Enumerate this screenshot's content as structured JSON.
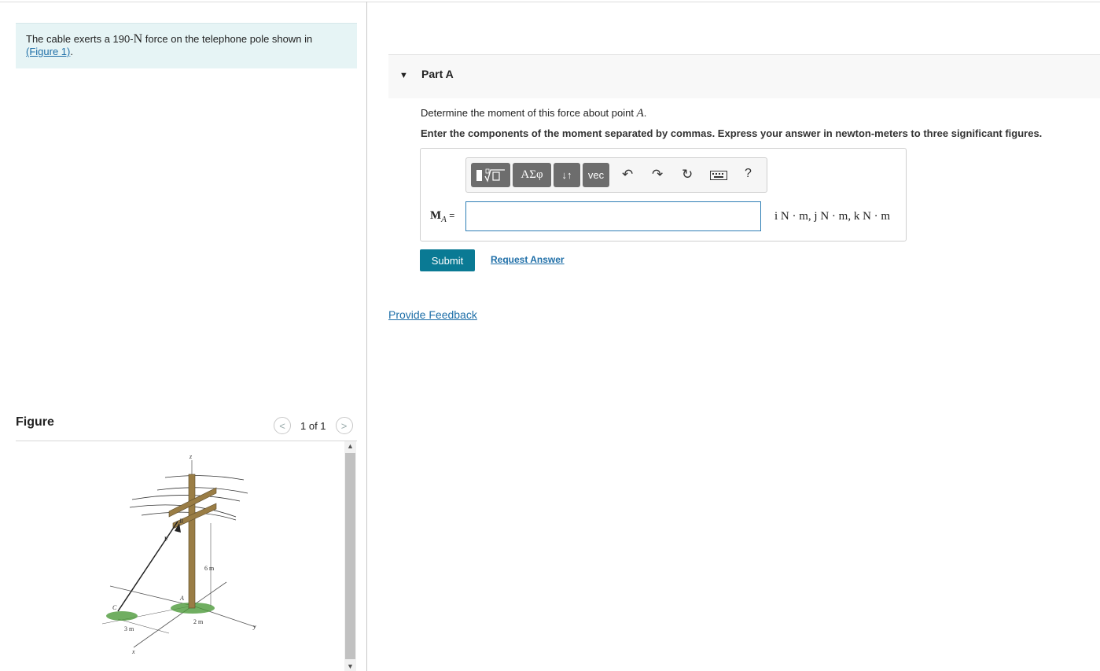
{
  "problem": {
    "text_before": "The cable exerts a 190-",
    "unit": "N",
    "text_after": " force on the telephone pole shown in",
    "figure_link": "(Figure 1)",
    "period": "."
  },
  "figure_panel": {
    "label": "Figure",
    "pager": "1 of 1",
    "prev_icon": "chevron-left-icon",
    "next_icon": "chevron-right-icon",
    "diagram_labels": {
      "z": "z",
      "y": "y",
      "x": "x",
      "b": "B",
      "f": "F",
      "a": "A",
      "c": "C",
      "dim_6m": "6 m",
      "dim_2m": "2 m",
      "dim_3m": "3 m"
    }
  },
  "part": {
    "title": "Part A",
    "question_prefix": "Determine the moment of this force about point ",
    "question_point": "A",
    "question_suffix": ".",
    "instructions": "Enter the components of the moment separated by commas. Express your answer in newton-meters to three significant figures."
  },
  "toolbar": {
    "template_icon": "template-radical-icon",
    "greek_label": "ΑΣφ",
    "sort_label": "↓↑",
    "vec_label": "vec",
    "undo_icon": "undo-icon",
    "redo_icon": "redo-icon",
    "reset_icon": "reset-icon",
    "keyboard_icon": "keyboard-icon",
    "help_label": "?"
  },
  "answer": {
    "label_main": "M",
    "label_sub": "A",
    "label_eq": " =",
    "value": "",
    "units": "i N · m, j N · m, k N · m"
  },
  "actions": {
    "submit": "Submit",
    "request_answer": "Request Answer",
    "feedback": "Provide Feedback"
  },
  "colors": {
    "accent": "#0a7a94",
    "link": "#1f6fa8",
    "problem_bg": "#e6f4f5",
    "toolbar_btn": "#6d6d6d"
  }
}
